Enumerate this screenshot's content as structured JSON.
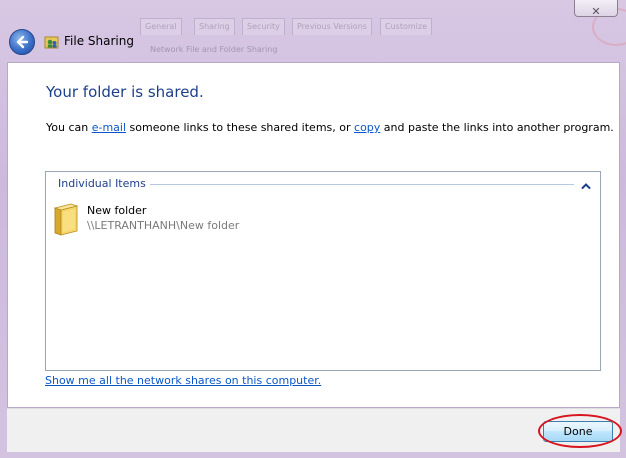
{
  "window": {
    "title": "File Sharing",
    "close_glyph": "✕",
    "background_tabs": [
      "General",
      "Sharing",
      "Security",
      "Previous Versions",
      "Customize"
    ],
    "background_text": "Network File and Folder Sharing"
  },
  "main": {
    "heading": "Your folder is shared.",
    "description": {
      "prefix": "You can ",
      "email_link": "e-mail",
      "middle": " someone links to these shared items, or ",
      "copy_link": "copy",
      "suffix": " and paste the links into another program."
    },
    "items_section": {
      "header": "Individual Items",
      "items": [
        {
          "name": "New folder",
          "path": "\\\\LETRANTHANH\\New folder",
          "icon": "folder-icon"
        }
      ]
    },
    "network_link": "Show me all the network shares on this computer."
  },
  "footer": {
    "done_label": "Done"
  },
  "colors": {
    "heading": "#1e3f8a",
    "link": "#0b57c9",
    "highlight_ring": "#d8141e"
  }
}
